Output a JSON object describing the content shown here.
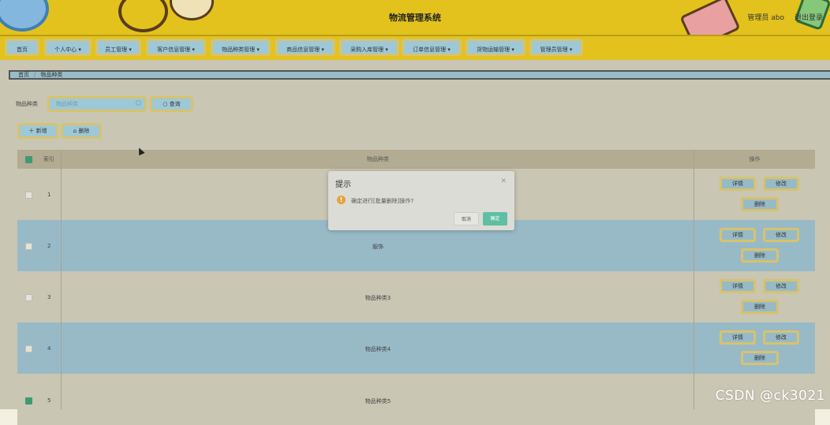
{
  "header": {
    "title": "物流管理系统",
    "admin": "管理员 abo",
    "logout": "退出登录"
  },
  "nav": [
    {
      "label": "首页"
    },
    {
      "label": "个人中心 ▾"
    },
    {
      "label": "员工管理 ▾"
    },
    {
      "label": "客户信息管理 ▾"
    },
    {
      "label": "物品种类管理 ▾"
    },
    {
      "label": "商品信息管理 ▾"
    },
    {
      "label": "采购入库管理 ▾"
    },
    {
      "label": "订单信息管理 ▾"
    },
    {
      "label": "货物运输管理 ▾"
    },
    {
      "label": "管理员管理 ▾"
    }
  ],
  "breadcrumb": {
    "home": "首页",
    "sep": "/",
    "current": "物品种类"
  },
  "filter": {
    "label": "物品种类",
    "placeholder": "物品种类",
    "search_label": "查询",
    "search_icon": "search-icon"
  },
  "actions": {
    "add_label": "＋ 新增",
    "delete_label": "删除"
  },
  "table": {
    "headers": {
      "index": "索引",
      "kind": "物品种类",
      "ops": "操作"
    },
    "rows": [
      {
        "index": "1",
        "kind": "",
        "checked": false
      },
      {
        "index": "2",
        "kind": "服饰",
        "checked": false
      },
      {
        "index": "3",
        "kind": "物品种类3",
        "checked": false
      },
      {
        "index": "4",
        "kind": "物品种类4",
        "checked": false
      },
      {
        "index": "5",
        "kind": "物品种类5",
        "checked": true
      }
    ],
    "row_actions": {
      "detail": "详情",
      "edit": "修改",
      "delete": "删除"
    }
  },
  "dialog": {
    "title": "提示",
    "message": "确定进行[批量删除]操作?",
    "cancel": "取消",
    "confirm": "确定"
  },
  "watermark": "CSDN @ck3021"
}
